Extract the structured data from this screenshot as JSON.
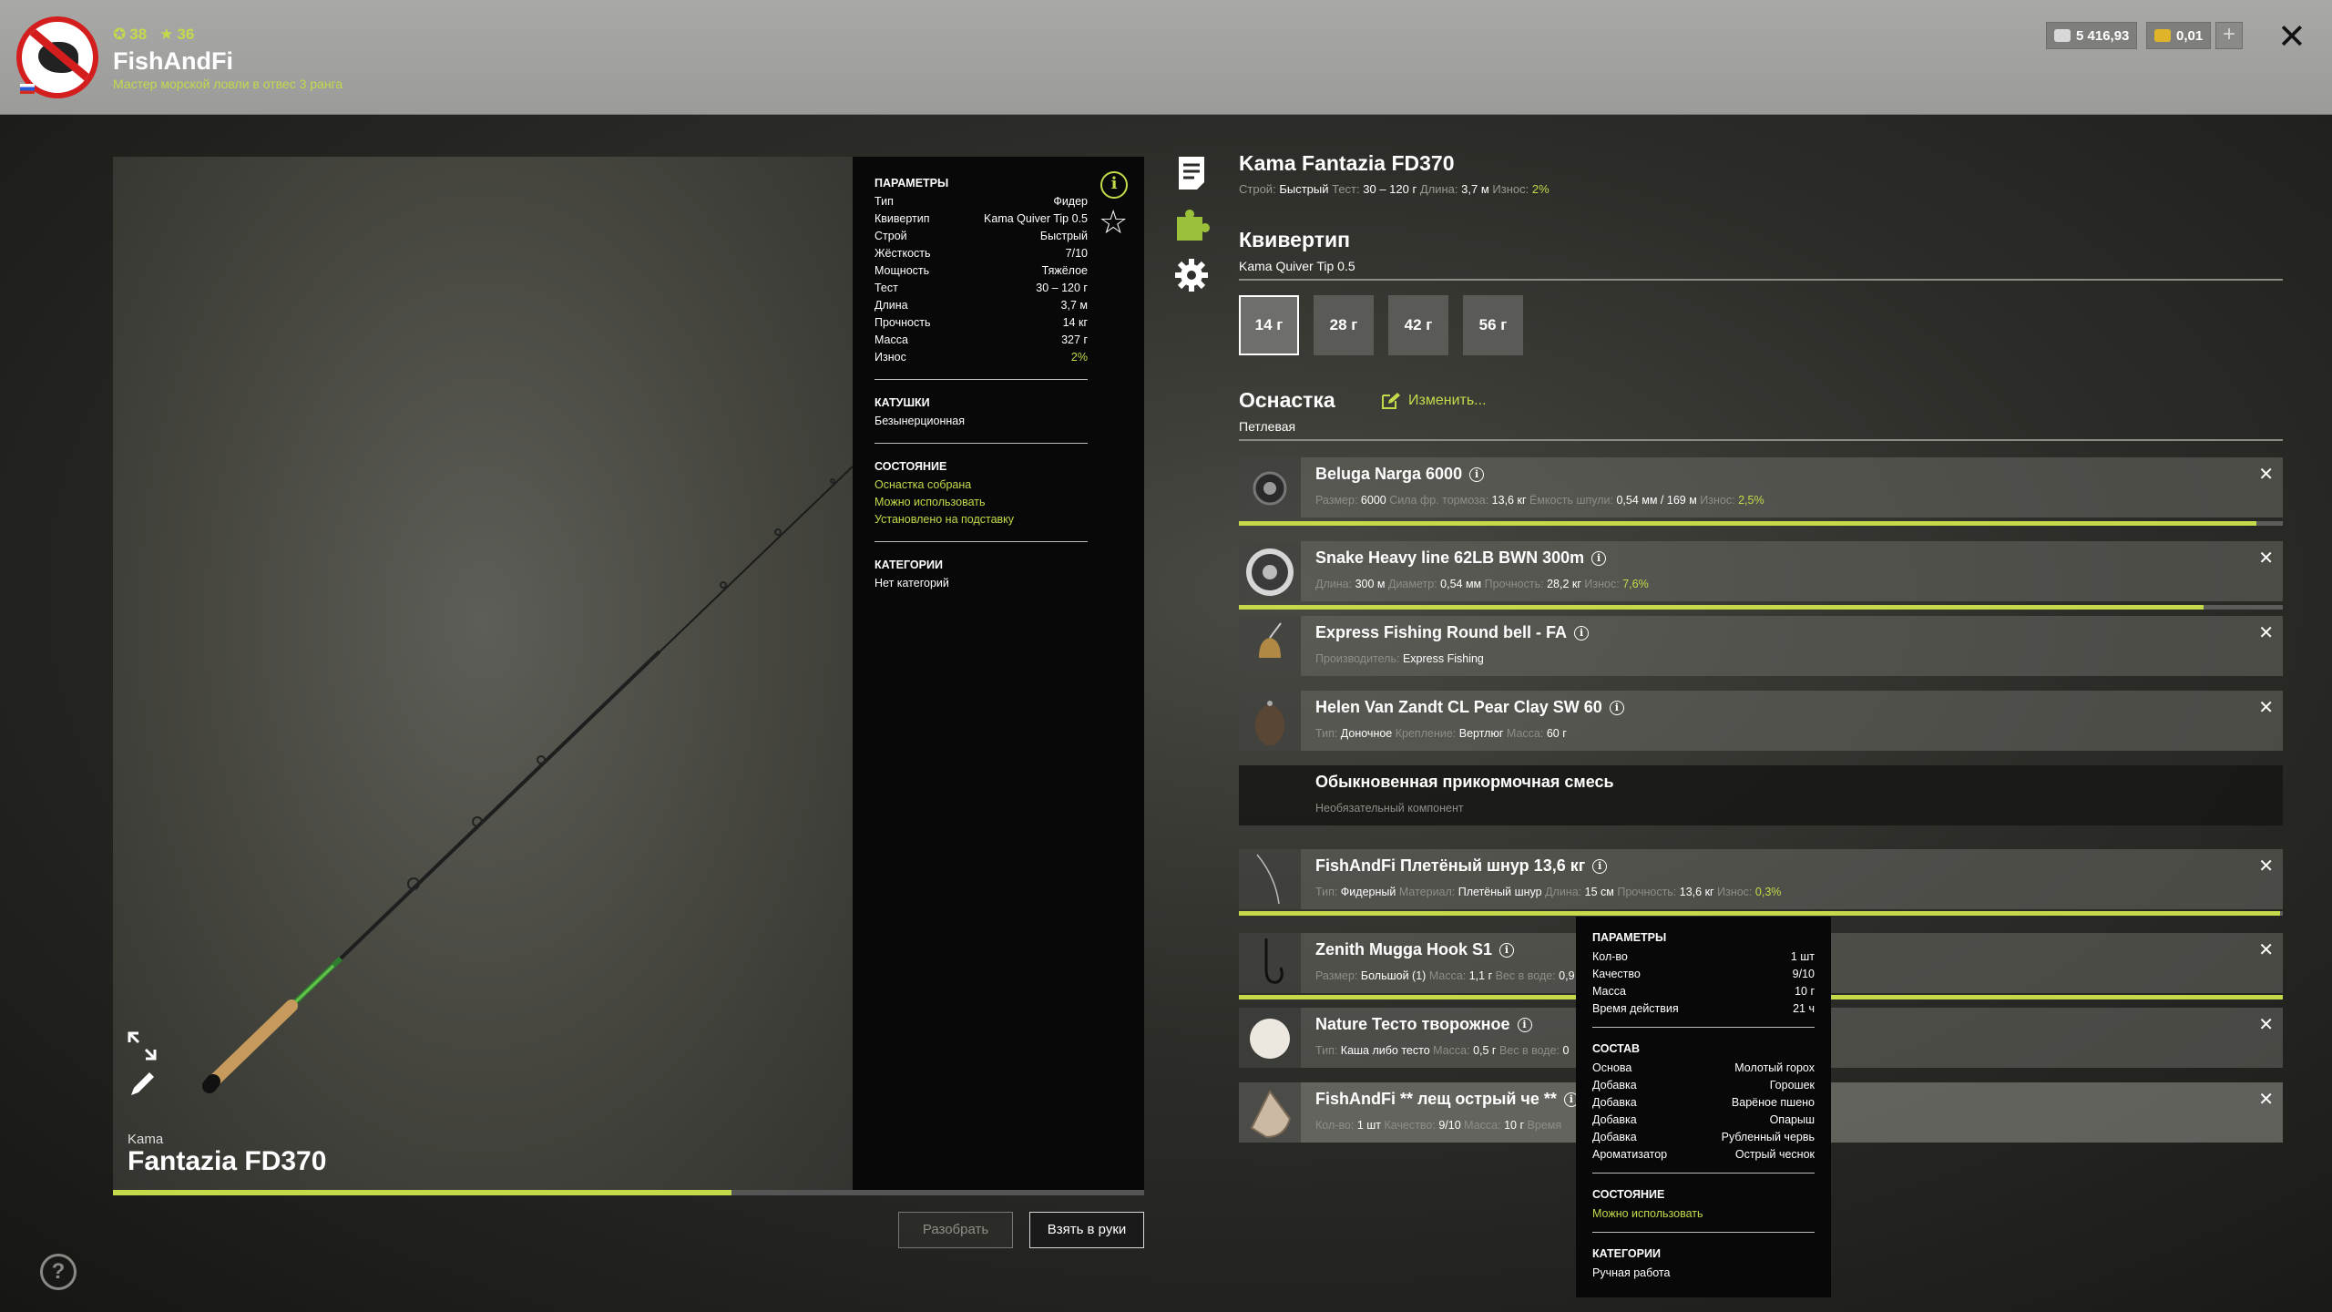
{
  "player": {
    "stat_level": "38",
    "stat_stars": "36",
    "name": "FishAndFi",
    "rank": "Мастер морской ловли в отвес 3 ранга"
  },
  "currency": {
    "silver": "5 416,93",
    "gold": "0,01",
    "plus": "+"
  },
  "icons": [
    "avatar-icon",
    "flag-icon",
    "silver-coin-icon",
    "gold-coin-icon",
    "plus-icon",
    "close-icon",
    "expand-icon",
    "pencil-icon",
    "info-icon",
    "star-icon",
    "description-icon",
    "puzzle-icon",
    "gear-icon",
    "edit-icon",
    "help-icon"
  ],
  "rod": {
    "brand": "Kama",
    "model": "Fantazia FD370",
    "condition_fraction": 0.6
  },
  "params": {
    "head": "ПАРАМЕТРЫ",
    "rows": [
      {
        "k": "Тип",
        "v": "Фидер"
      },
      {
        "k": "Квивертип",
        "v": "Kama Quiver Tip 0.5"
      },
      {
        "k": "Строй",
        "v": "Быстрый"
      },
      {
        "k": "Жёсткость",
        "v": "7/10"
      },
      {
        "k": "Мощность",
        "v": "Тяжёлое"
      },
      {
        "k": "Тест",
        "v": "30 – 120 г"
      },
      {
        "k": "Длина",
        "v": "3,7 м"
      },
      {
        "k": "Прочность",
        "v": "14 кг"
      },
      {
        "k": "Масса",
        "v": "327 г"
      },
      {
        "k": "Износ",
        "v": "2%"
      }
    ],
    "reels_head": "КАТУШКИ",
    "reels_value": "Безынерционная",
    "state_head": "СОСТОЯНИЕ",
    "state": [
      "Оснастка собрана",
      "Можно использовать",
      "Установлено на подставку"
    ],
    "cats_head": "КАТЕГОРИИ",
    "cats_value": "Нет категорий"
  },
  "buttons": {
    "disassemble": "Разобрать",
    "take": "Взять в руки"
  },
  "details": {
    "title": "Kama Fantazia FD370",
    "sub": {
      "build_l": "Строй:",
      "build_v": "Быстрый",
      "test_l": "Тест:",
      "test_v": "30 – 120 г",
      "len_l": "Длина:",
      "len_v": "3,7 м",
      "wear_l": "Износ:",
      "wear_v": "2%"
    },
    "quiver_title": "Квивертип",
    "quiver_value": "Kama Quiver Tip 0.5",
    "weights": [
      "14 г",
      "28 г",
      "42 г",
      "56 г"
    ],
    "rig_title": "Оснастка",
    "rig_value": "Петлевая",
    "change": "Изменить..."
  },
  "items": [
    {
      "name": "Beluga Narga 6000",
      "props": [
        [
          "Размер:",
          "6000"
        ],
        [
          "Сила фр. тормоза:",
          "13,6 кг"
        ],
        [
          "Ёмкость шпули:",
          "0,54 мм / 169 м"
        ],
        [
          "Износ:",
          "2,5%"
        ]
      ],
      "wear": 0.975
    },
    {
      "name": "Snake Heavy line 62LB BWN 300m",
      "props": [
        [
          "Длина:",
          "300 м"
        ],
        [
          "Диаметр:",
          "0,54 мм"
        ],
        [
          "Прочность:",
          "28,2 кг"
        ],
        [
          "Износ:",
          "7,6%"
        ]
      ],
      "wear": 0.924
    },
    {
      "name": "Express Fishing Round bell - FA",
      "props": [
        [
          "Производитель:",
          "Express Fishing"
        ]
      ]
    },
    {
      "name": "Helen Van Zandt CL Pear Clay SW 60",
      "props": [
        [
          "Тип:",
          "Доночное"
        ],
        [
          "Крепление:",
          "Вертлюг"
        ],
        [
          "Масса:",
          "60 г"
        ]
      ]
    },
    {
      "name": "Обыкновенная прикормочная смесь",
      "note": "Необязательный компонент"
    },
    {
      "name": "FishAndFi Плетёный шнур 13,6 кг",
      "props": [
        [
          "Тип:",
          "Фидерный"
        ],
        [
          "Материал:",
          "Плетёный шнур"
        ],
        [
          "Длина:",
          "15 см"
        ],
        [
          "Прочность:",
          "13,6 кг"
        ],
        [
          "Износ:",
          "0,3%"
        ]
      ],
      "wear": 0.997
    },
    {
      "name": "Zenith Mugga Hook S1",
      "props": [
        [
          "Размер:",
          "Большой (1)"
        ],
        [
          "Масса:",
          "1,1 г"
        ],
        [
          "Вес в воде:",
          "0,9"
        ]
      ],
      "wear": 1.0
    },
    {
      "name": "Nature Тесто творожное",
      "props": [
        [
          "Тип:",
          "Каша либо тесто"
        ],
        [
          "Масса:",
          "0,5 г"
        ],
        [
          "Вес в воде:",
          "0"
        ]
      ]
    },
    {
      "name": "FishAndFi ** лещ острый че **",
      "props": [
        [
          "Кол-во:",
          "1 шт"
        ],
        [
          "Качество:",
          "9/10"
        ],
        [
          "Масса:",
          "10 г"
        ],
        [
          "Время",
          ""
        ]
      ]
    }
  ],
  "tooltip": {
    "params_head": "ПАРАМЕТРЫ",
    "params": [
      {
        "k": "Кол-во",
        "v": "1 шт"
      },
      {
        "k": "Качество",
        "v": "9/10"
      },
      {
        "k": "Масса",
        "v": "10 г"
      },
      {
        "k": "Время действия",
        "v": "21 ч"
      }
    ],
    "comp_head": "СОСТАВ",
    "comp": [
      {
        "k": "Основа",
        "v": "Молотый горох"
      },
      {
        "k": "Добавка",
        "v": "Горошек"
      },
      {
        "k": "Добавка",
        "v": "Варёное пшено"
      },
      {
        "k": "Добавка",
        "v": "Опарыш"
      },
      {
        "k": "Добавка",
        "v": "Рубленный червь"
      },
      {
        "k": "Ароматизатор",
        "v": "Острый чеснок"
      }
    ],
    "state_head": "СОСТОЯНИЕ",
    "state": "Можно использовать",
    "cats_head": "КАТЕГОРИИ",
    "cats": "Ручная работа"
  },
  "colors": {
    "accent": "#c5d94a",
    "danger": "#d41e1e"
  }
}
